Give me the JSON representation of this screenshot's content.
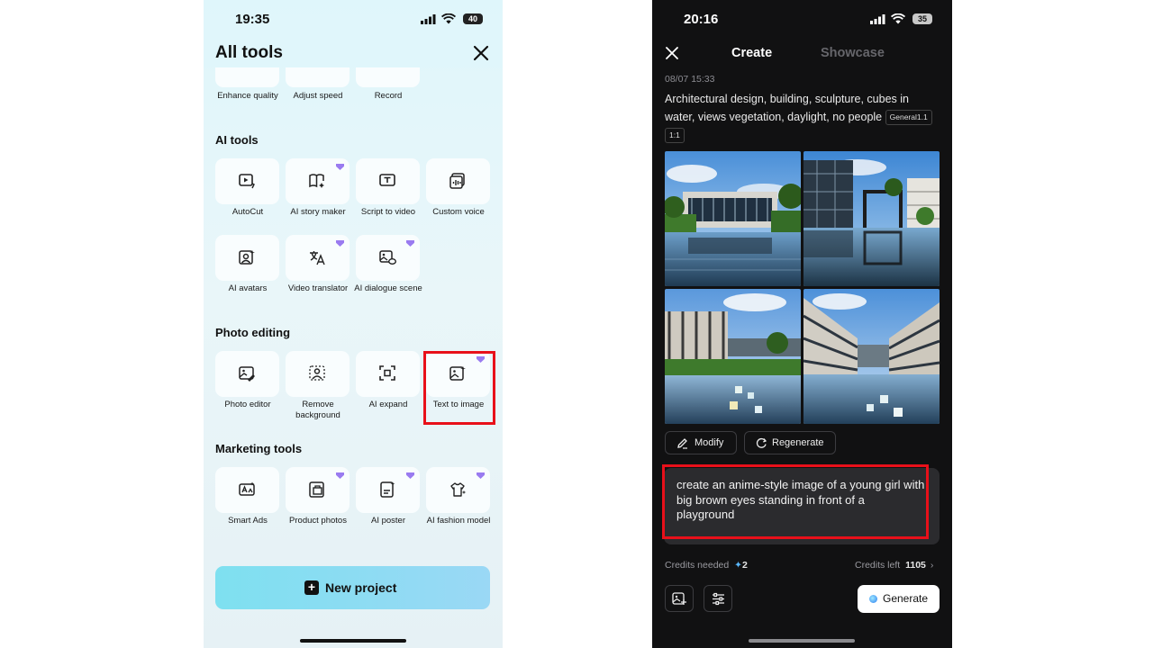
{
  "left": {
    "status_time": "19:35",
    "battery": "40",
    "title": "All tools",
    "top_tools": [
      {
        "label": "Enhance quality"
      },
      {
        "label": "Adjust speed"
      },
      {
        "label": "Record"
      }
    ],
    "sections": [
      {
        "title": "AI tools",
        "tools": [
          {
            "label": "AutoCut",
            "icon": "autocut-icon",
            "premium": false
          },
          {
            "label": "AI story maker",
            "icon": "story-icon",
            "premium": true
          },
          {
            "label": "Script to video",
            "icon": "script-icon",
            "premium": false
          },
          {
            "label": "Custom voice",
            "icon": "voice-icon",
            "premium": false
          },
          {
            "label": "AI avatars",
            "icon": "avatar-icon",
            "premium": false
          },
          {
            "label": "Video translator",
            "icon": "translate-icon",
            "premium": true
          },
          {
            "label": "AI dialogue scene",
            "icon": "dialogue-icon",
            "premium": true
          }
        ]
      },
      {
        "title": "Photo editing",
        "tools": [
          {
            "label": "Photo editor",
            "icon": "photo-edit-icon",
            "premium": false
          },
          {
            "label": "Remove background",
            "icon": "remove-bg-icon",
            "premium": false
          },
          {
            "label": "AI expand",
            "icon": "expand-icon",
            "premium": false
          },
          {
            "label": "Text to image",
            "icon": "text-image-icon",
            "premium": true
          }
        ]
      },
      {
        "title": "Marketing tools",
        "tools": [
          {
            "label": "Smart Ads",
            "icon": "ads-icon",
            "premium": false
          },
          {
            "label": "Product photos",
            "icon": "product-icon",
            "premium": true
          },
          {
            "label": "AI poster",
            "icon": "poster-icon",
            "premium": true
          },
          {
            "label": "AI fashion model",
            "icon": "fashion-icon",
            "premium": true
          }
        ]
      }
    ],
    "new_project": "New project",
    "highlight_color": "#e8101a",
    "premium_color": "#9a7bf0"
  },
  "right": {
    "status_time": "20:16",
    "battery": "35",
    "tabs": {
      "create": "Create",
      "showcase": "Showcase"
    },
    "date": "08/07 15:33",
    "prompt": "Architectural design, building, sculpture, cubes in water, views vegetation, daylight, no people",
    "chips": [
      "General1.1",
      "1:1"
    ],
    "modify": "Modify",
    "regenerate": "Regenerate",
    "input_text": "create an anime-style image of a young girl with big brown eyes standing in front of a playground",
    "credits_needed_label": "Credits needed",
    "credits_needed_value": "2",
    "credits_left_label": "Credits left",
    "credits_left_value": "1105",
    "generate": "Generate"
  }
}
